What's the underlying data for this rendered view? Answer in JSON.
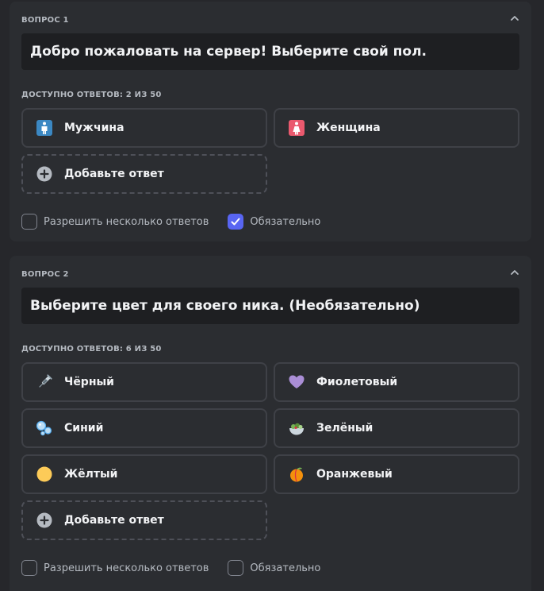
{
  "questions": [
    {
      "label": "ВОПРОС 1",
      "title": "Добро пожаловать на сервер! Выберите свой пол.",
      "available": "ДОСТУПНО ОТВЕТОВ: 2 ИЗ 50",
      "options": [
        {
          "label": "Мужчина",
          "icon": "man-sign-icon",
          "color": "#3b88c3"
        },
        {
          "label": "Женщина",
          "icon": "woman-sign-icon",
          "color": "#ea596e"
        }
      ],
      "add_label": "Добавьте ответ",
      "multi_label": "Разрешить несколько ответов",
      "multi_checked": false,
      "required_label": "Обязательно",
      "required_checked": true
    },
    {
      "label": "ВОПРОС 2",
      "title": "Выберите цвет для своего ника. (Необязательно)",
      "available": "ДОСТУПНО ОТВЕТОВ: 6 ИЗ 50",
      "options": [
        {
          "label": "Чёрный",
          "icon": "syringe-icon"
        },
        {
          "label": "Фиолетовый",
          "icon": "purple-heart-icon",
          "color": "#aa8ed6"
        },
        {
          "label": "Синий",
          "icon": "bubbles-icon",
          "color": "#55acee"
        },
        {
          "label": "Зелёный",
          "icon": "salad-icon",
          "color": "#77b255"
        },
        {
          "label": "Жёлтый",
          "icon": "yellow-circle-icon",
          "color": "#fdcb58"
        },
        {
          "label": "Оранжевый",
          "icon": "peach-icon",
          "color": "#f4900c"
        }
      ],
      "add_label": "Добавьте ответ",
      "multi_label": "Разрешить несколько ответов",
      "multi_checked": false,
      "required_label": "Обязательно",
      "required_checked": false
    }
  ],
  "colors": {
    "background": "#26272b",
    "card": "#2b2d31",
    "input": "#1e1f22",
    "accent": "#5865f2",
    "border": "#3f4147"
  }
}
